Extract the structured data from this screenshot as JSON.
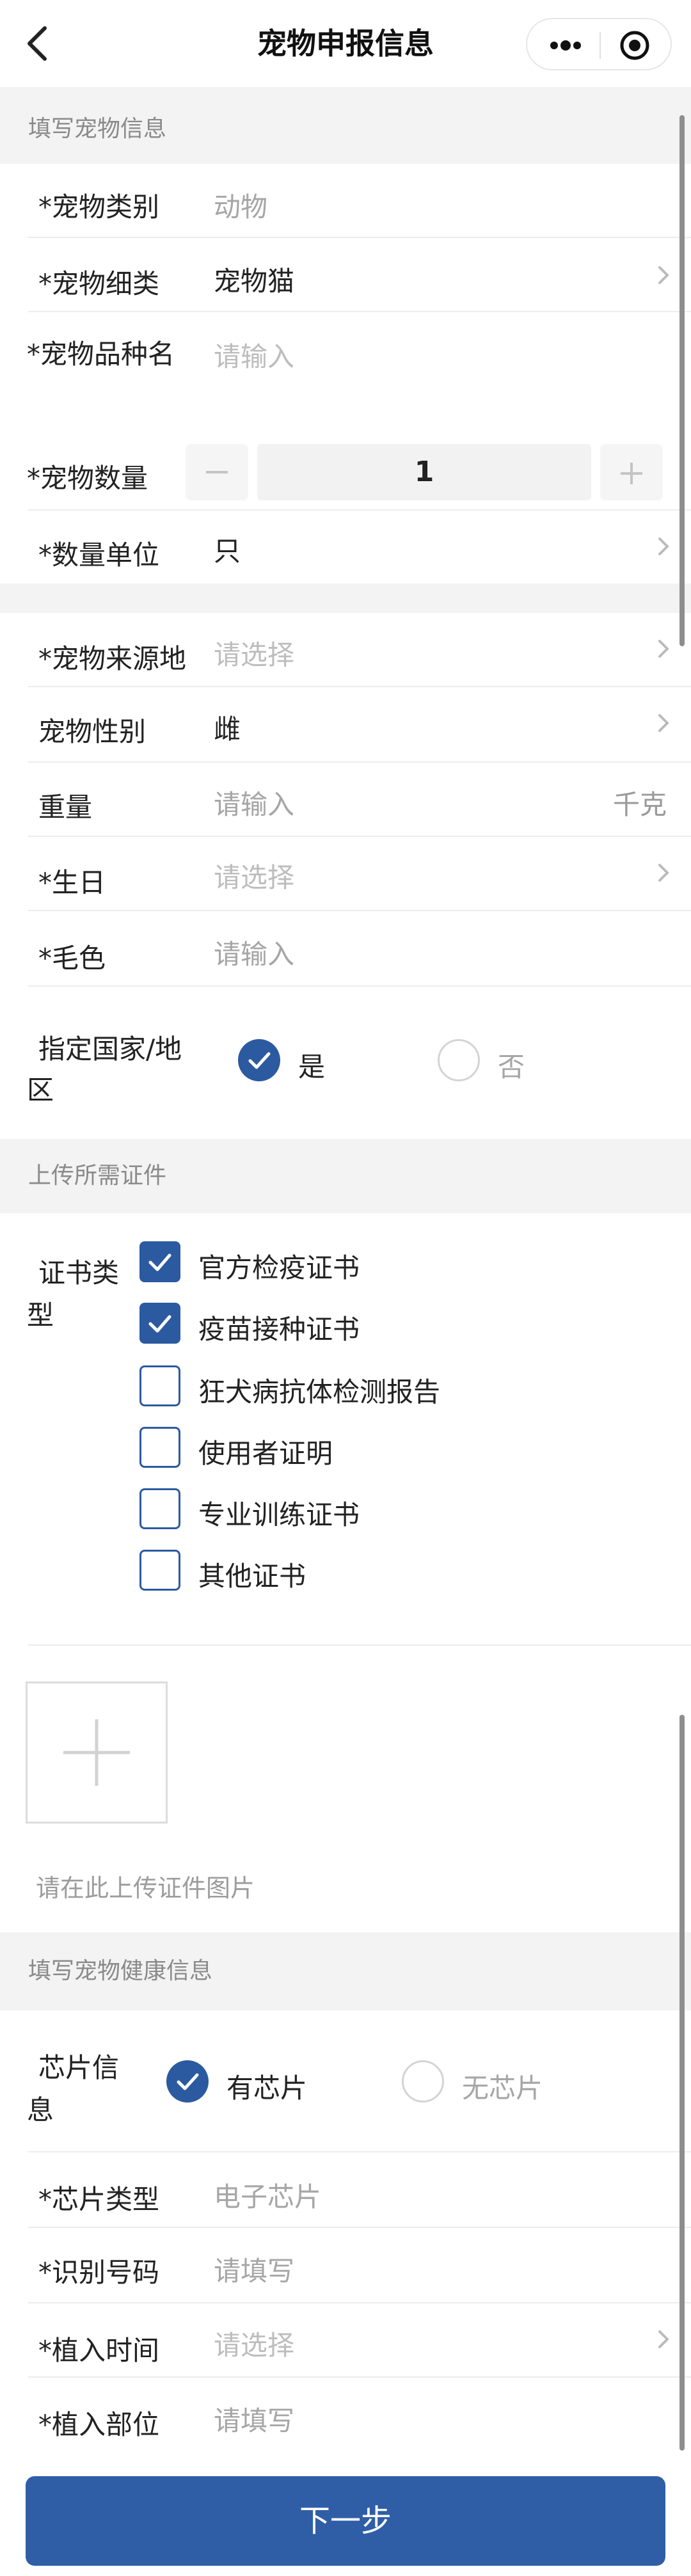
{
  "header": {
    "title": "宠物申报信息",
    "back_icon": "chevron-left-icon",
    "more_icon": "more-dots-icon",
    "close_icon": "target-close-icon"
  },
  "pet_info": {
    "section_title": "填写宠物信息",
    "category": {
      "label": "*宠物类别",
      "value": "动物"
    },
    "subcategory": {
      "label": "*宠物细类",
      "value": "宠物猫"
    },
    "breed": {
      "label": "*宠物品种名",
      "placeholder": "请输入"
    },
    "quantity": {
      "label": "*宠物数量",
      "value": "1",
      "minus": "−",
      "plus": "+"
    },
    "unit": {
      "label": "*数量单位",
      "value": "只"
    },
    "origin": {
      "label": "*宠物来源地",
      "placeholder": "请选择"
    },
    "gender": {
      "label": "宠物性别",
      "value": "雌"
    },
    "weight": {
      "label": "重量",
      "placeholder": "请输入",
      "unit": "千克"
    },
    "birthday": {
      "label": "*生日",
      "placeholder": "请选择"
    },
    "color": {
      "label": "*毛色",
      "placeholder": "请输入"
    },
    "country": {
      "label_line1": "指定国家/地",
      "label_line2": "区",
      "options": [
        {
          "label": "是",
          "selected": true
        },
        {
          "label": "否",
          "selected": false
        }
      ]
    }
  },
  "certificates": {
    "section_title": "上传所需证件",
    "type_label_line1": "证书类",
    "type_label_line2": "型",
    "options": [
      {
        "label": "官方检疫证书",
        "checked": true
      },
      {
        "label": "疫苗接种证书",
        "checked": true
      },
      {
        "label": "狂犬病抗体检测报告",
        "checked": false
      },
      {
        "label": "使用者证明",
        "checked": false
      },
      {
        "label": "专业训练证书",
        "checked": false
      },
      {
        "label": "其他证书",
        "checked": false
      }
    ],
    "upload_icon": "plus-icon",
    "upload_hint": "请在此上传证件图片"
  },
  "health": {
    "section_title": "填写宠物健康信息",
    "chip": {
      "label_line1": "芯片信",
      "label_line2": "息",
      "options": [
        {
          "label": "有芯片",
          "selected": true
        },
        {
          "label": "无芯片",
          "selected": false
        }
      ]
    },
    "chip_type": {
      "label": "*芯片类型",
      "value": "电子芯片"
    },
    "id_number": {
      "label": "*识别号码",
      "placeholder": "请填写"
    },
    "implant_time": {
      "label": "*植入时间",
      "placeholder": "请选择"
    },
    "implant_site": {
      "label": "*植入部位",
      "placeholder": "请填写"
    }
  },
  "footer": {
    "next_label": "下一步"
  },
  "colors": {
    "accent": "#2c5aa0",
    "button": "#2f5ea6",
    "section_bg": "#f3f3f3",
    "placeholder": "#bdbdbd"
  }
}
